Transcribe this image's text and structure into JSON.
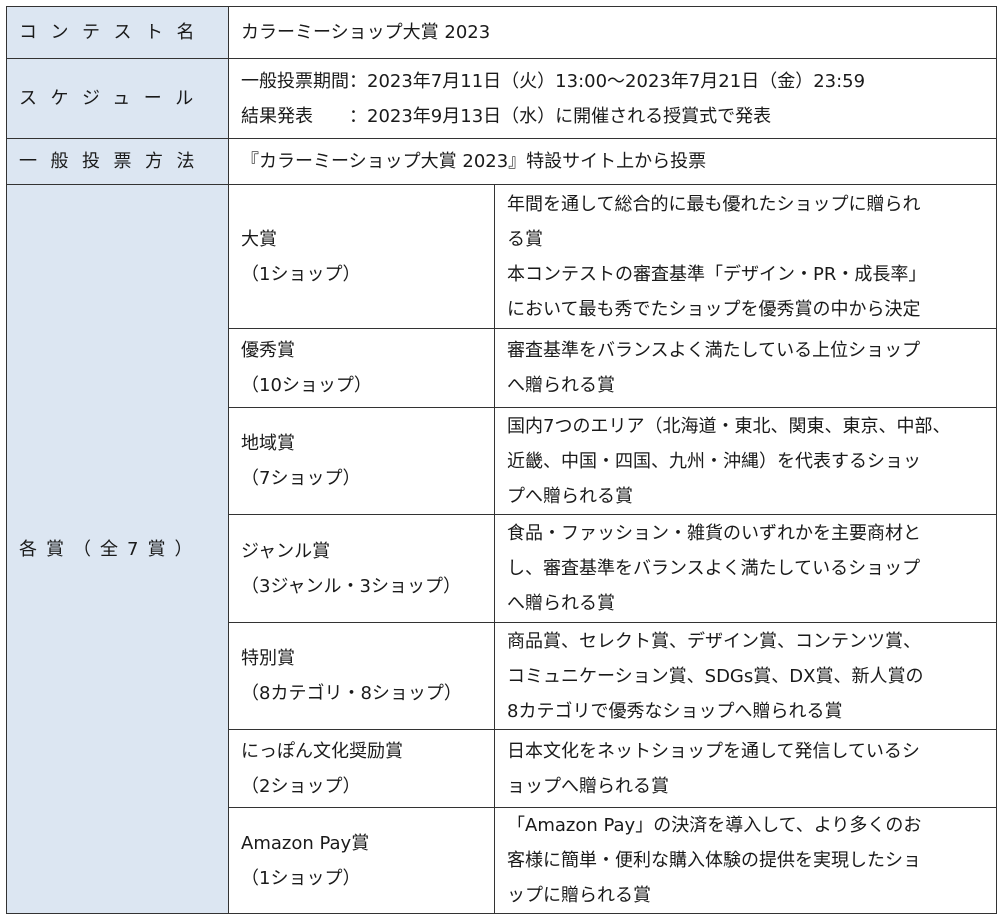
{
  "rows": {
    "contest_name": {
      "label": "コンテスト名",
      "value": "カラーミーショップ大賞 2023"
    },
    "schedule": {
      "label": "スケジュール",
      "lines": [
        "一般投票期間：2023年7月11日（火）13:00～2023年7月21日（金）23:59",
        "結果発表　　：2023年9月13日（水）に開催される授賞式で発表"
      ]
    },
    "voting_method": {
      "label": "一般投票方法",
      "value": "『カラーミーショップ大賞 2023』特設サイト上から投票"
    },
    "awards": {
      "label": "各賞（全7賞）",
      "items": [
        {
          "name": "大賞",
          "count": "（1ショップ）",
          "description": [
            "年間を通して総合的に最も優れたショップに贈られ",
            "る賞",
            "本コンテストの審査基準「デザイン・PR・成長率」",
            "において最も秀でたショップを優秀賞の中から決定"
          ]
        },
        {
          "name": "優秀賞",
          "count": "（10ショップ）",
          "description": [
            "審査基準をバランスよく満たしている上位ショップ",
            "へ贈られる賞"
          ]
        },
        {
          "name": "地域賞",
          "count": "（7ショップ）",
          "description": [
            "国内7つのエリア（北海道・東北、関東、東京、中部、",
            "近畿、中国・四国、九州・沖縄）を代表するショッ",
            "プへ贈られる賞"
          ]
        },
        {
          "name": "ジャンル賞",
          "count": "（3ジャンル・3ショップ）",
          "description": [
            "食品・ファッション・雑貨のいずれかを主要商材と",
            "し、審査基準をバランスよく満たしているショップ",
            "へ贈られる賞"
          ]
        },
        {
          "name": "特別賞",
          "count": "（8カテゴリ・8ショップ）",
          "description": [
            "商品賞、セレクト賞、デザイン賞、コンテンツ賞、",
            "コミュニケーション賞、SDGs賞、DX賞、新人賞の",
            "8カテゴリで優秀なショップへ贈られる賞"
          ]
        },
        {
          "name": "にっぽん文化奨励賞",
          "count": "（2ショップ）",
          "description": [
            "日本文化をネットショップを通して発信しているシ",
            "ョップへ贈られる賞"
          ]
        },
        {
          "name": "Amazon Pay賞",
          "count": "（1ショップ）",
          "description": [
            "「Amazon Pay」の決済を導入して、より多くのお",
            "客様に簡単・便利な購入体験の提供を実現したショ",
            "ップに贈られる賞"
          ]
        }
      ]
    }
  }
}
